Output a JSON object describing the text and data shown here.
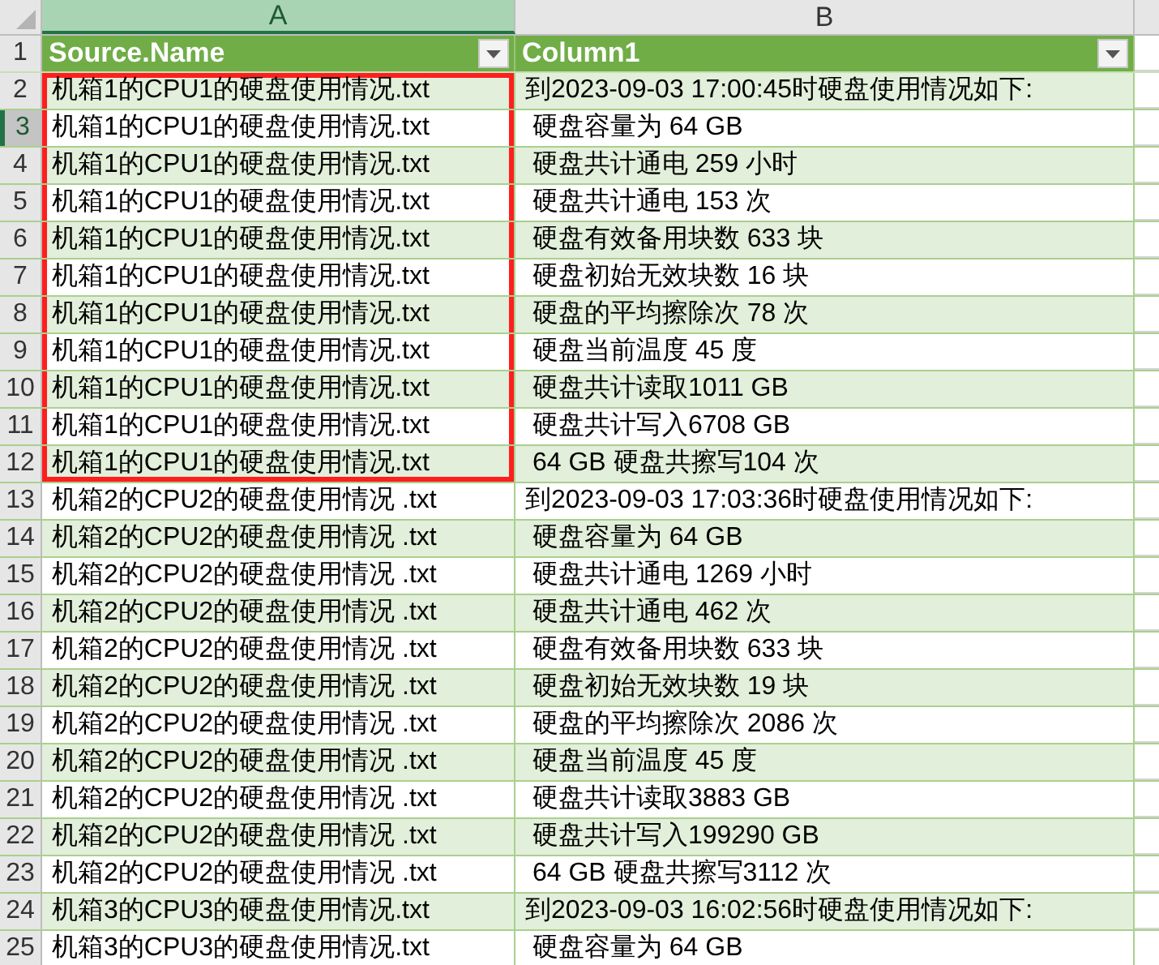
{
  "columns": [
    {
      "letter": "A",
      "selected": true
    },
    {
      "letter": "B",
      "selected": false
    }
  ],
  "header": {
    "number": "1",
    "cells": [
      "Source.Name",
      "Column1"
    ]
  },
  "rows": [
    {
      "number": "2",
      "selected": false,
      "outlined": true,
      "cells": [
        "机箱1的CPU1的硬盘使用情况.txt",
        "到2023-09-03 17:00:45时硬盘使用情况如下:"
      ]
    },
    {
      "number": "3",
      "selected": true,
      "outlined": true,
      "cells": [
        "机箱1的CPU1的硬盘使用情况.txt",
        " 硬盘容量为 64 GB"
      ]
    },
    {
      "number": "4",
      "selected": false,
      "outlined": true,
      "cells": [
        "机箱1的CPU1的硬盘使用情况.txt",
        " 硬盘共计通电 259 小时"
      ]
    },
    {
      "number": "5",
      "selected": false,
      "outlined": true,
      "cells": [
        "机箱1的CPU1的硬盘使用情况.txt",
        " 硬盘共计通电 153 次"
      ]
    },
    {
      "number": "6",
      "selected": false,
      "outlined": true,
      "cells": [
        "机箱1的CPU1的硬盘使用情况.txt",
        " 硬盘有效备用块数 633 块"
      ]
    },
    {
      "number": "7",
      "selected": false,
      "outlined": true,
      "cells": [
        "机箱1的CPU1的硬盘使用情况.txt",
        " 硬盘初始无效块数 16 块"
      ]
    },
    {
      "number": "8",
      "selected": false,
      "outlined": true,
      "cells": [
        "机箱1的CPU1的硬盘使用情况.txt",
        " 硬盘的平均擦除次 78 次"
      ]
    },
    {
      "number": "9",
      "selected": false,
      "outlined": true,
      "cells": [
        "机箱1的CPU1的硬盘使用情况.txt",
        " 硬盘当前温度 45 度"
      ]
    },
    {
      "number": "10",
      "selected": false,
      "outlined": true,
      "cells": [
        "机箱1的CPU1的硬盘使用情况.txt",
        " 硬盘共计读取1011 GB"
      ]
    },
    {
      "number": "11",
      "selected": false,
      "outlined": true,
      "cells": [
        "机箱1的CPU1的硬盘使用情况.txt",
        " 硬盘共计写入6708 GB"
      ]
    },
    {
      "number": "12",
      "selected": false,
      "outlined": true,
      "cells": [
        "机箱1的CPU1的硬盘使用情况.txt",
        " 64 GB 硬盘共擦写104 次"
      ]
    },
    {
      "number": "13",
      "selected": false,
      "outlined": false,
      "cells": [
        "机箱2的CPU2的硬盘使用情况 .txt",
        "到2023-09-03 17:03:36时硬盘使用情况如下:"
      ]
    },
    {
      "number": "14",
      "selected": false,
      "outlined": false,
      "cells": [
        "机箱2的CPU2的硬盘使用情况 .txt",
        " 硬盘容量为 64 GB"
      ]
    },
    {
      "number": "15",
      "selected": false,
      "outlined": false,
      "cells": [
        "机箱2的CPU2的硬盘使用情况 .txt",
        " 硬盘共计通电 1269 小时"
      ]
    },
    {
      "number": "16",
      "selected": false,
      "outlined": false,
      "cells": [
        "机箱2的CPU2的硬盘使用情况 .txt",
        " 硬盘共计通电 462 次"
      ]
    },
    {
      "number": "17",
      "selected": false,
      "outlined": false,
      "cells": [
        "机箱2的CPU2的硬盘使用情况 .txt",
        " 硬盘有效备用块数 633 块"
      ]
    },
    {
      "number": "18",
      "selected": false,
      "outlined": false,
      "cells": [
        "机箱2的CPU2的硬盘使用情况 .txt",
        " 硬盘初始无效块数 19 块"
      ]
    },
    {
      "number": "19",
      "selected": false,
      "outlined": false,
      "cells": [
        "机箱2的CPU2的硬盘使用情况 .txt",
        " 硬盘的平均擦除次 2086 次"
      ]
    },
    {
      "number": "20",
      "selected": false,
      "outlined": false,
      "cells": [
        "机箱2的CPU2的硬盘使用情况 .txt",
        " 硬盘当前温度 45 度"
      ]
    },
    {
      "number": "21",
      "selected": false,
      "outlined": false,
      "cells": [
        "机箱2的CPU2的硬盘使用情况 .txt",
        " 硬盘共计读取3883 GB"
      ]
    },
    {
      "number": "22",
      "selected": false,
      "outlined": false,
      "cells": [
        "机箱2的CPU2的硬盘使用情况 .txt",
        " 硬盘共计写入199290 GB"
      ]
    },
    {
      "number": "23",
      "selected": false,
      "outlined": false,
      "cells": [
        "机箱2的CPU2的硬盘使用情况 .txt",
        " 64 GB 硬盘共擦写3112 次"
      ]
    },
    {
      "number": "24",
      "selected": false,
      "outlined": false,
      "cells": [
        "机箱3的CPU3的硬盘使用情况.txt",
        "到2023-09-03 16:02:56时硬盘使用情况如下:"
      ]
    },
    {
      "number": "25",
      "selected": false,
      "outlined": false,
      "cells": [
        "机箱3的CPU3的硬盘使用情况.txt",
        " 硬盘容量为 64 GB"
      ]
    }
  ]
}
